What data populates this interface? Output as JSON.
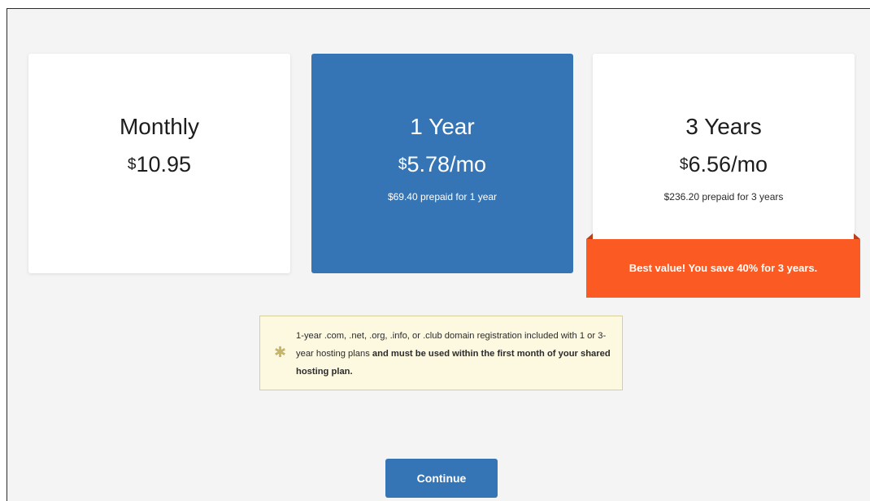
{
  "plans": [
    {
      "id": "monthly",
      "name": "Monthly",
      "currency": "$",
      "price": "10.95",
      "period": "",
      "prepaid": ""
    },
    {
      "id": "1year",
      "name": "1 Year",
      "currency": "$",
      "price": "5.78",
      "period": "/mo",
      "prepaid": "$69.40 prepaid for 1 year",
      "selected": true
    },
    {
      "id": "3years",
      "name": "3 Years",
      "currency": "$",
      "price": "6.56",
      "period": "/mo",
      "prepaid": "$236.20 prepaid for 3 years"
    }
  ],
  "ribbon": {
    "text": "Best value! You save 40% for 3 years."
  },
  "notice": {
    "icon": "asterisk-icon",
    "text_normal": "1-year .com, .net, .org, .info, or .club domain registration included with 1 or 3-year hosting plans ",
    "text_bold": "and must be used within the first month of your shared hosting plan."
  },
  "actions": {
    "continue_label": "Continue"
  },
  "colors": {
    "selected_card": "#3575b5",
    "ribbon": "#fb5b22",
    "notice_bg": "#fdf8e0",
    "button": "#3575b5"
  }
}
